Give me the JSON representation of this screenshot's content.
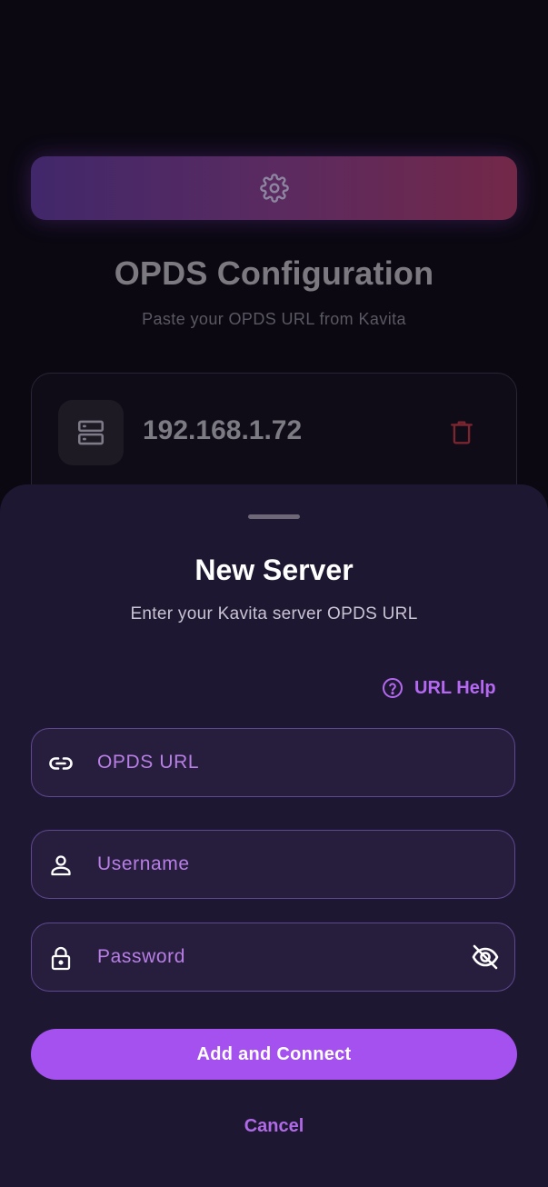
{
  "background": {
    "title": "OPDS Configuration",
    "subtitle": "Paste your OPDS URL from Kavita",
    "server": {
      "name": "192.168.1.72"
    }
  },
  "sheet": {
    "title": "New Server",
    "subtitle": "Enter your Kavita server OPDS URL",
    "url_help": "URL Help",
    "fields": {
      "url": {
        "placeholder": "OPDS URL",
        "value": ""
      },
      "username": {
        "placeholder": "Username",
        "value": ""
      },
      "password": {
        "placeholder": "Password",
        "value": ""
      }
    },
    "primary_label": "Add and Connect",
    "cancel_label": "Cancel"
  },
  "icons": {
    "gear": "gear-icon",
    "server": "server-icon",
    "trash": "trash-icon",
    "help": "help-circle-icon",
    "link": "link-icon",
    "person": "person-icon",
    "lock": "lock-icon",
    "eye_off": "eye-off-icon"
  },
  "colors": {
    "accent": "#a451f0",
    "sheet_bg": "#1e1731",
    "field_bg": "#271e3e",
    "field_border": "#5e4891",
    "danger": "#7a2530"
  }
}
